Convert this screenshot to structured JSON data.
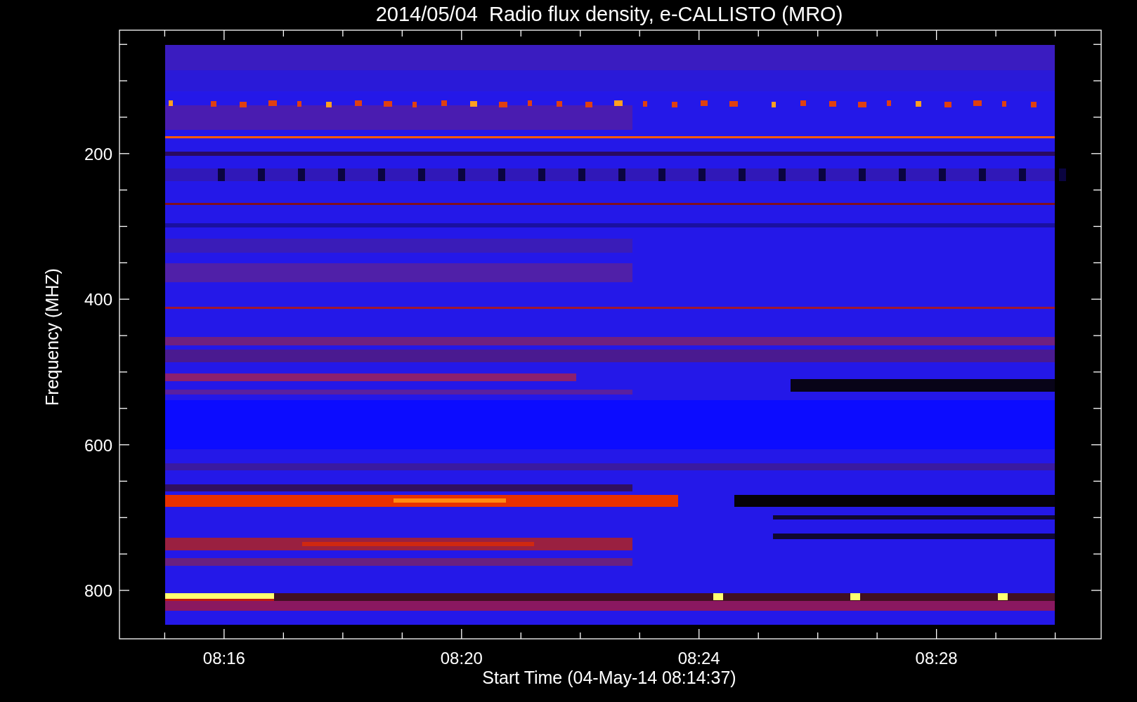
{
  "title": "2014/05/04  Radio flux density, e-CALLISTO (MRO)",
  "plot": {
    "ylabel": "Frequency (MHZ)",
    "xlabel": "Start Time (04-May-14 08:14:37)",
    "yticks": [
      "200",
      "400",
      "600",
      "800"
    ],
    "xticks": [
      "08:16",
      "08:20",
      "08:24",
      "08:28"
    ]
  }
}
